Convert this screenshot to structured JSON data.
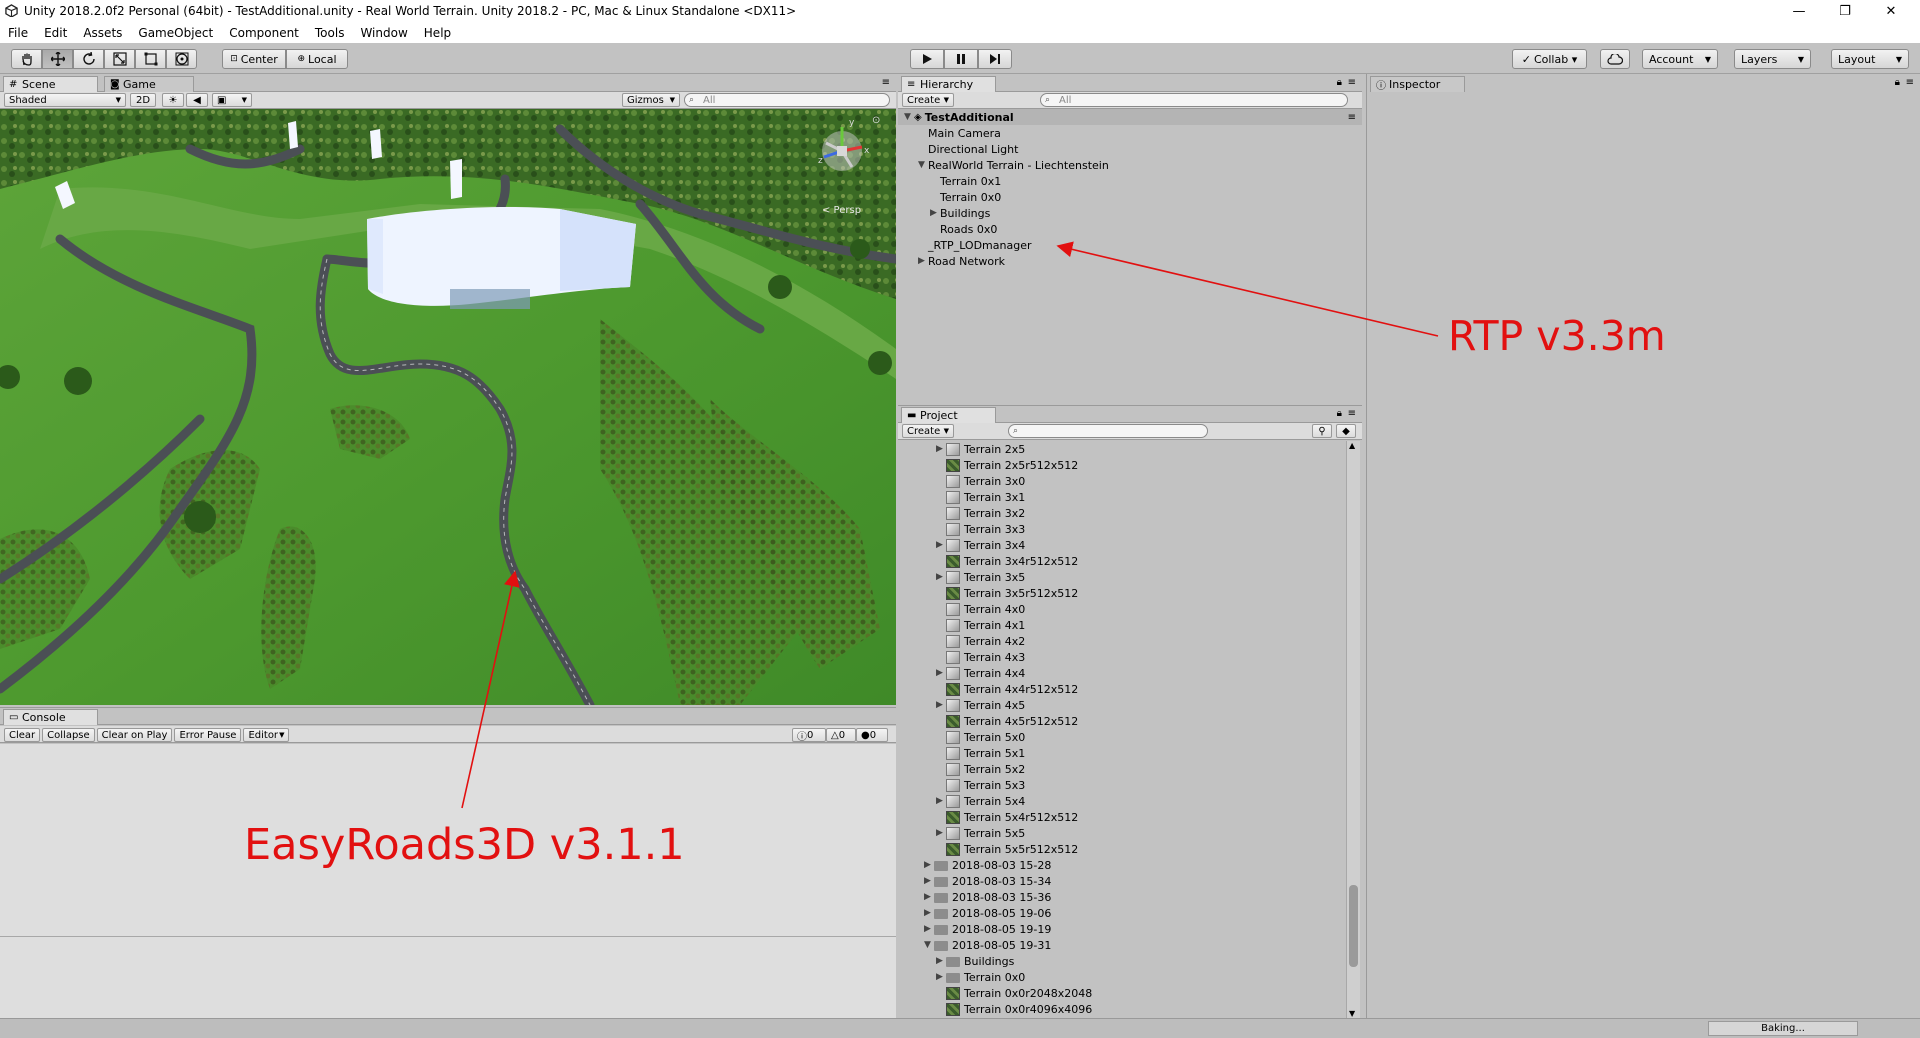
{
  "window": {
    "title": "Unity 2018.2.0f2 Personal (64bit) - TestAdditional.unity - Real World Terrain. Unity 2018.2 - PC, Mac & Linux Standalone <DX11>",
    "minimize": "—",
    "maximize": "❐",
    "close": "✕"
  },
  "menu": [
    "File",
    "Edit",
    "Assets",
    "GameObject",
    "Component",
    "Tools",
    "Window",
    "Help"
  ],
  "toolbar": {
    "tools": [
      "hand",
      "move",
      "rotate",
      "scale",
      "rect",
      "transform"
    ],
    "pivot": "Center",
    "space": "Local",
    "collab": "Collab ▾",
    "account": "Account",
    "layers": "Layers",
    "layout": "Layout"
  },
  "scene": {
    "tab_scene": "Scene",
    "tab_game": "Game",
    "shading": "Shaded",
    "mode_2d": "2D",
    "gizmos": "Gizmos",
    "search_placeholder": "All",
    "persp_label": "< Persp",
    "gizmo_x": "x",
    "gizmo_y": "y",
    "gizmo_z": "z"
  },
  "console": {
    "tab": "Console",
    "buttons": [
      "Clear",
      "Collapse",
      "Clear on Play",
      "Error Pause",
      "Editor"
    ],
    "count_info": "0",
    "count_warn": "0",
    "count_error": "0"
  },
  "hierarchy": {
    "tab": "Hierarchy",
    "create": "Create",
    "search_placeholder": "All",
    "scene_name": "TestAdditional",
    "items": [
      {
        "label": "Main Camera",
        "indent": 1,
        "arrow": ""
      },
      {
        "label": "Directional Light",
        "indent": 1,
        "arrow": ""
      },
      {
        "label": "RealWorld Terrain - Liechtenstein",
        "indent": 1,
        "arrow": "▼"
      },
      {
        "label": "Terrain 0x1",
        "indent": 2,
        "arrow": ""
      },
      {
        "label": "Terrain 0x0",
        "indent": 2,
        "arrow": ""
      },
      {
        "label": "Buildings",
        "indent": 2,
        "arrow": "▶"
      },
      {
        "label": "Roads 0x0",
        "indent": 2,
        "arrow": ""
      },
      {
        "label": "_RTP_LODmanager",
        "indent": 1,
        "arrow": ""
      },
      {
        "label": "Road Network",
        "indent": 1,
        "arrow": "▶"
      }
    ]
  },
  "project": {
    "tab": "Project",
    "create": "Create",
    "items": [
      {
        "label": "Terrain 2x5",
        "kind": "cube",
        "indent": 3,
        "arrow": "▶"
      },
      {
        "label": "Terrain 2x5r512x512",
        "kind": "tex",
        "indent": 3,
        "arrow": ""
      },
      {
        "label": "Terrain 3x0",
        "kind": "cube",
        "indent": 3,
        "arrow": ""
      },
      {
        "label": "Terrain 3x1",
        "kind": "cube",
        "indent": 3,
        "arrow": ""
      },
      {
        "label": "Terrain 3x2",
        "kind": "cube",
        "indent": 3,
        "arrow": ""
      },
      {
        "label": "Terrain 3x3",
        "kind": "cube",
        "indent": 3,
        "arrow": ""
      },
      {
        "label": "Terrain 3x4",
        "kind": "cube",
        "indent": 3,
        "arrow": "▶"
      },
      {
        "label": "Terrain 3x4r512x512",
        "kind": "tex",
        "indent": 3,
        "arrow": ""
      },
      {
        "label": "Terrain 3x5",
        "kind": "cube",
        "indent": 3,
        "arrow": "▶"
      },
      {
        "label": "Terrain 3x5r512x512",
        "kind": "tex",
        "indent": 3,
        "arrow": ""
      },
      {
        "label": "Terrain 4x0",
        "kind": "cube",
        "indent": 3,
        "arrow": ""
      },
      {
        "label": "Terrain 4x1",
        "kind": "cube",
        "indent": 3,
        "arrow": ""
      },
      {
        "label": "Terrain 4x2",
        "kind": "cube",
        "indent": 3,
        "arrow": ""
      },
      {
        "label": "Terrain 4x3",
        "kind": "cube",
        "indent": 3,
        "arrow": ""
      },
      {
        "label": "Terrain 4x4",
        "kind": "cube",
        "indent": 3,
        "arrow": "▶"
      },
      {
        "label": "Terrain 4x4r512x512",
        "kind": "tex",
        "indent": 3,
        "arrow": ""
      },
      {
        "label": "Terrain 4x5",
        "kind": "cube",
        "indent": 3,
        "arrow": "▶"
      },
      {
        "label": "Terrain 4x5r512x512",
        "kind": "tex",
        "indent": 3,
        "arrow": ""
      },
      {
        "label": "Terrain 5x0",
        "kind": "cube",
        "indent": 3,
        "arrow": ""
      },
      {
        "label": "Terrain 5x1",
        "kind": "cube",
        "indent": 3,
        "arrow": ""
      },
      {
        "label": "Terrain 5x2",
        "kind": "cube",
        "indent": 3,
        "arrow": ""
      },
      {
        "label": "Terrain 5x3",
        "kind": "cube",
        "indent": 3,
        "arrow": ""
      },
      {
        "label": "Terrain 5x4",
        "kind": "cube",
        "indent": 3,
        "arrow": "▶"
      },
      {
        "label": "Terrain 5x4r512x512",
        "kind": "tex",
        "indent": 3,
        "arrow": ""
      },
      {
        "label": "Terrain 5x5",
        "kind": "cube",
        "indent": 3,
        "arrow": "▶"
      },
      {
        "label": "Terrain 5x5r512x512",
        "kind": "tex",
        "indent": 3,
        "arrow": ""
      },
      {
        "label": "2018-08-03 15-28",
        "kind": "folder",
        "indent": 2,
        "arrow": "▶"
      },
      {
        "label": "2018-08-03 15-34",
        "kind": "folder",
        "indent": 2,
        "arrow": "▶"
      },
      {
        "label": "2018-08-03 15-36",
        "kind": "folder",
        "indent": 2,
        "arrow": "▶"
      },
      {
        "label": "2018-08-05 19-06",
        "kind": "folder",
        "indent": 2,
        "arrow": "▶"
      },
      {
        "label": "2018-08-05 19-19",
        "kind": "folder",
        "indent": 2,
        "arrow": "▶"
      },
      {
        "label": "2018-08-05 19-31",
        "kind": "folder",
        "indent": 2,
        "arrow": "▼"
      },
      {
        "label": "Buildings",
        "kind": "folder",
        "indent": 3,
        "arrow": "▶"
      },
      {
        "label": "Terrain 0x0",
        "kind": "folder",
        "indent": 3,
        "arrow": "▶"
      },
      {
        "label": "Terrain 0x0r2048x2048",
        "kind": "tex",
        "indent": 3,
        "arrow": ""
      },
      {
        "label": "Terrain 0x0r4096x4096",
        "kind": "tex",
        "indent": 3,
        "arrow": ""
      }
    ]
  },
  "inspector": {
    "tab": "Inspector"
  },
  "status": {
    "baking": "Baking..."
  },
  "annotations": {
    "rtp": "RTP v3.3m",
    "easyroads": "EasyRoads3D v3.1.1",
    "color": "#e21010"
  }
}
